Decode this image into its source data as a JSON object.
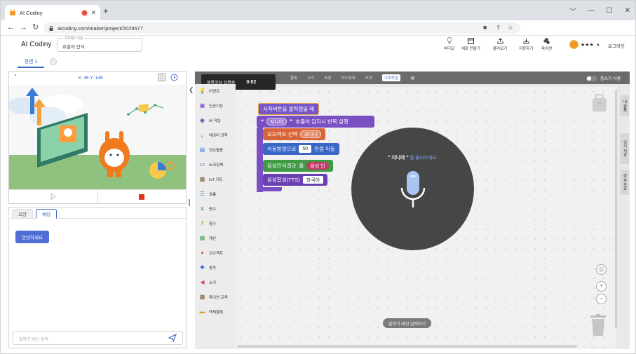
{
  "browser": {
    "tab_title": "AI Codiny",
    "new_tab": "+",
    "url": "aicodiny.com/maker/project/2029577",
    "window_controls": [
      "﹀",
      "—",
      "☐",
      "✕"
    ]
  },
  "app": {
    "logo": "AI Codiny",
    "project_caption": "프로젝트 이름",
    "project_name": "호출어 인식",
    "toolbar": {
      "video": "비디오",
      "new": "새로 만들기",
      "load": "불러오기",
      "save": "저장하기",
      "python": "파이썬"
    },
    "user_name": "★★★",
    "logout": "로그아웃"
  },
  "scene": {
    "tab": "장면 1"
  },
  "stage": {
    "coords": "X: 46 Y: 146"
  },
  "chat": {
    "tabs": [
      "모양",
      "채팅"
    ],
    "active_tab": "채팅",
    "greeting": "안녕하세요",
    "input_placeholder": "말하기 대신 입력"
  },
  "workspace": {
    "timer_label": "블록코딩 실행중",
    "timer_value": "0:02",
    "category_tabs": [
      "블록",
      "소리",
      "속성",
      "하드웨어",
      "모양",
      "기초학습"
    ],
    "active_category_tab": "기초학습",
    "mute_label": "음소거 사용",
    "categories": [
      {
        "label": "이벤트",
        "icon": "event-icon",
        "color": "#e6a23c"
      },
      {
        "label": "인공지능",
        "icon": "ai-robot-icon",
        "color": "#7c4fc7"
      },
      {
        "label": "AI 학습",
        "icon": "ai-learn-icon",
        "color": "#6a3aa8"
      },
      {
        "label": "데이터 과학",
        "icon": "chart-icon",
        "color": "#5a5fc7"
      },
      {
        "label": "정보활용",
        "icon": "info-icon",
        "color": "#3a7bd5"
      },
      {
        "label": "AI코딩팩",
        "icon": "pack-icon",
        "color": "#2b4a9e"
      },
      {
        "label": "IoT 키트",
        "icon": "iot-icon",
        "color": "#7a5a2a"
      },
      {
        "label": "흐름",
        "icon": "flow-icon",
        "color": "#3a9ad9"
      },
      {
        "label": "변수",
        "icon": "variable-icon",
        "color": "#3a9e3a"
      },
      {
        "label": "함수",
        "icon": "function-icon",
        "color": "#c9a227"
      },
      {
        "label": "계산",
        "icon": "calc-icon",
        "color": "#49a44a"
      },
      {
        "label": "오브젝트",
        "icon": "object-icon",
        "color": "#d9653a"
      },
      {
        "label": "동작",
        "icon": "move-icon",
        "color": "#2a5fc7"
      },
      {
        "label": "소리",
        "icon": "sound-icon",
        "color": "#d94060"
      },
      {
        "label": "파이썬 교육",
        "icon": "python-edu-icon",
        "color": "#7a5a2a"
      },
      {
        "label": "액체블록",
        "icon": "liquid-block-icon",
        "color": "#e89c30"
      }
    ],
    "blocks": {
      "start": "시작버튼을 클릭했을 때",
      "wake_word_quote_open": "❝",
      "wake_word": "지니야",
      "wake_word_quote_close": "❞",
      "wake_word_suffix": "호출어 감지시 반복 실행",
      "object_select": "오브젝트 선택",
      "object_name": "코디니",
      "move_dir": "이동방향으로",
      "move_value": "50",
      "move_suffix": "만큼 이동",
      "voice_result": "음성인식결과",
      "voice_eq": "를",
      "voice_partial": "음성 인",
      "tts": "음성합성(TTS)",
      "tts_lang": "한국어"
    },
    "overlay": {
      "quote_word": "\" 지니야 \"",
      "instruction": "를 불러주세요."
    },
    "type_instead": "말하기 대신 입력하기",
    "right_tabs": [
      "내 블록",
      "임시 저장",
      "학습 자료"
    ]
  }
}
